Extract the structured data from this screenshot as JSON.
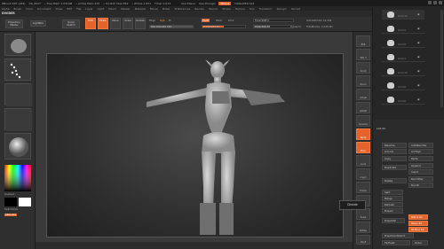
{
  "titlebar": {
    "app": "ZBrush 4R7 (x64)",
    "file": "QS_0027",
    "items": [
      "• Free Mem 1.031GB",
      "• Active Mem 415",
      "• Scratch Disk 819",
      "• ZTime 1.651",
      "Timer 0.013"
    ],
    "quicksave": "QuickSave",
    "seethrough": "See-through",
    "menus_label": "Menus",
    "script": "DefaultZScript"
  },
  "menubar": {
    "items": [
      "Alpha",
      "Brush",
      "Color",
      "Document",
      "Draw",
      "Edit",
      "File",
      "Layer",
      "Light",
      "Macro",
      "Marker",
      "Material",
      "Movie",
      "Picker",
      "Preferences",
      "Render",
      "Stencil",
      "Stroke",
      "Texture",
      "Tool",
      "Transform",
      "Zplugin",
      "Zscript"
    ]
  },
  "divider_title": "DIVIDER",
  "topbar": {
    "projection_master": "Projection Master",
    "lightbox": "LightBox",
    "quick_sketch": "Quick Sketch",
    "edit": "Edit",
    "draw": "Draw",
    "move": "Move",
    "scale": "Scale",
    "rotate": "Rotate",
    "mrgb": "Mrgb",
    "rgb": "Rgb",
    "m": "M",
    "rgb_intensity": "Rgb Intensity 100",
    "zadd": "Zadd",
    "zsub": "Zsub",
    "zcut": "Zcut",
    "z_intensity": "Z Intensity 51",
    "focal_shift": "Focal Shift 0",
    "draw_size": "Draw Size 52",
    "dynamic": "Dynamic",
    "active_points": "ActivePoints: 12,241",
    "total_points": "TotalPoints: 1.045 Mil"
  },
  "leftshelf": {
    "labels": [
      "",
      "",
      "",
      "",
      ""
    ],
    "gradient": "Gradient",
    "switch_color": "SwitchColor",
    "alternate": "Alternate"
  },
  "rightshelf": {
    "buttons": [
      "BPR",
      "SPix 3",
      "Scroll",
      "Zoom",
      "Actual",
      "AAHalf",
      "Dynamic",
      "Persp",
      "Floor",
      "Local",
      "L.Sym",
      "Frame",
      "Move",
      "Scale",
      "Rotate",
      "PolyF",
      "Transp",
      "Solo"
    ]
  },
  "tray": {
    "subtools": [
      "Armor10",
      "Armor9",
      "Armor8",
      "Armor4",
      "Armor10",
      "Armor6",
      "Armor6"
    ],
    "list_all": "List All",
    "buttons": {
      "rename": "Rename",
      "auto_reorder": "AutoReorder",
      "all_low": "All Low",
      "all_high": "All High",
      "copy": "Copy",
      "paste": "Paste",
      "duplicate": "Duplicate",
      "append": "Append",
      "insert": "Insert",
      "delete": "Delete",
      "del_other": "Del Other",
      "del_all": "Del All",
      "split": "Split",
      "merge": "Merge",
      "remesh": "Remesh",
      "project": "Project",
      "project_all": "ProjectAll",
      "dist": "Dist 0.02",
      "mean": "Mean 25",
      "pa_blur": "PA Blur 10",
      "project_shell": "ProjectionShell 0",
      "farthest": "Farthest",
      "outer": "Outer",
      "inner": "Inner",
      "extract": "Extract"
    }
  },
  "tooltip": "Divide",
  "colors": {
    "accent": "#e3632a",
    "background": "#2a2a2a"
  }
}
